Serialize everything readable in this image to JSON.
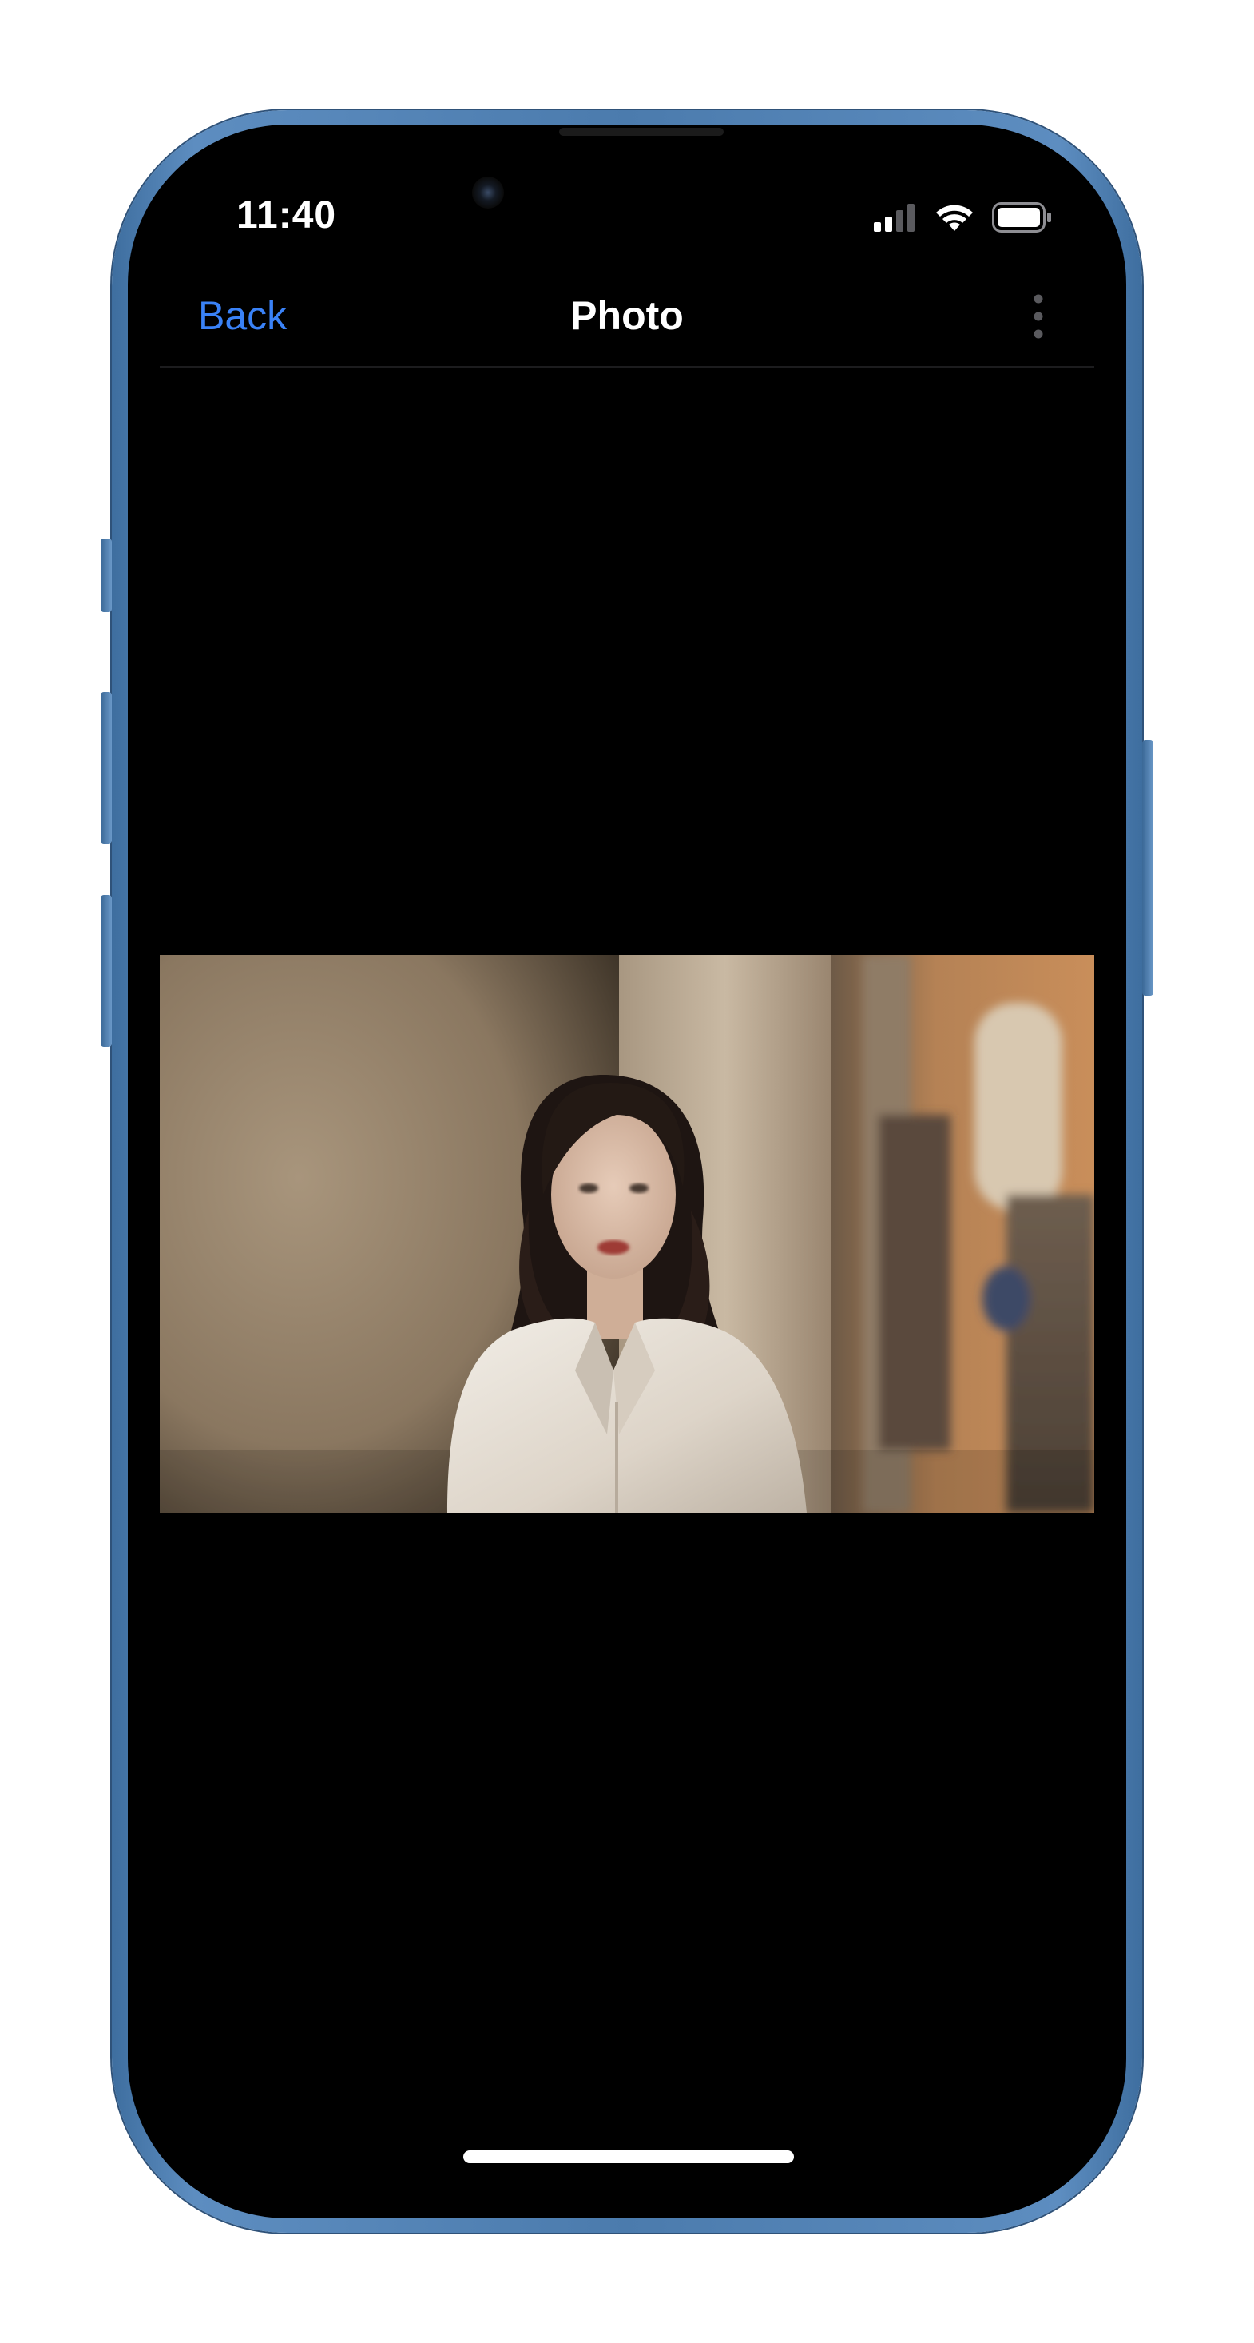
{
  "status_bar": {
    "time": "11:40",
    "icons": [
      "cellular-signal-icon",
      "wifi-icon",
      "battery-icon"
    ]
  },
  "nav": {
    "back_label": "Back",
    "title": "Photo",
    "more_icon": "vertical-ellipsis-icon"
  },
  "photo": {
    "description_icon": "portrait-photo"
  },
  "colors": {
    "accent": "#3a82f7",
    "background": "#000000",
    "frame": "#4b7bad"
  }
}
